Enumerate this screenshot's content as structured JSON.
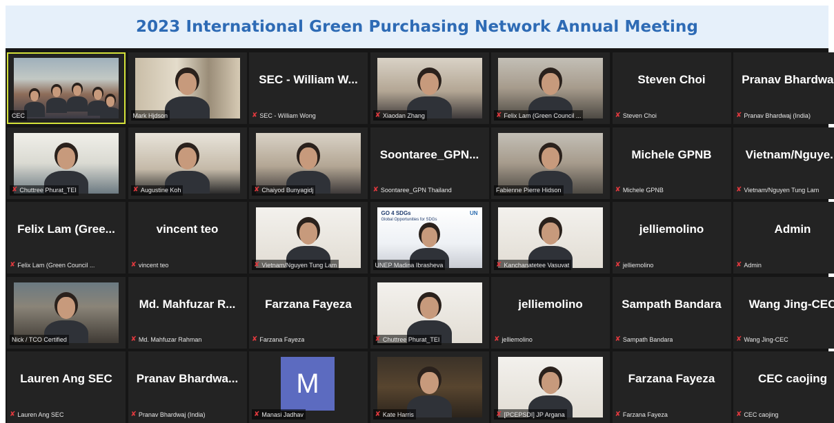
{
  "header": {
    "title": "2023 International Green Purchasing Network Annual Meeting"
  },
  "tiles": [
    {
      "big": "",
      "label": "CEC",
      "video": "v-room",
      "mic": false
    },
    {
      "big": "",
      "label": "Mark Hjdson",
      "video": "v-shelf",
      "mic": false
    },
    {
      "big": "SEC - William W...",
      "label": "SEC - William Wong",
      "video": "",
      "mic": true
    },
    {
      "big": "",
      "label": "Xiaodan Zhang",
      "video": "v-wall",
      "mic": true
    },
    {
      "big": "",
      "label": "Felix Lam (Green Council ...",
      "video": "v-room2",
      "mic": true
    },
    {
      "big": "Steven Choi",
      "label": "Steven Choi",
      "video": "",
      "mic": true
    },
    {
      "big": "Pranav  Bhardwa...",
      "label": "Pranav Bhardwaj (India)",
      "video": "",
      "mic": true
    },
    {
      "big": "",
      "label": "Chuttree Phurat_TEI",
      "video": "v-office",
      "mic": true
    },
    {
      "big": "",
      "label": "Augustine Koh",
      "video": "v-window",
      "mic": true
    },
    {
      "big": "",
      "label": "Chaiyod Bunyagidj",
      "video": "v-wall",
      "mic": true
    },
    {
      "big": "Soontaree_GPN...",
      "label": "Soontaree_GPN Thailand",
      "video": "",
      "mic": true
    },
    {
      "big": "",
      "label": "Fabienne Pierre Hidson",
      "video": "v-room2",
      "mic": false
    },
    {
      "big": "Michele GPNB",
      "label": "Michele GPNB",
      "video": "",
      "mic": true
    },
    {
      "big": "Vietnam/Nguye...",
      "label": "Vietnam/Nguyen Tung Lam",
      "video": "",
      "mic": true
    },
    {
      "big": "Felix Lam  (Gree...",
      "label": "Felix Lam (Green Council ...",
      "video": "",
      "mic": true
    },
    {
      "big": "vincent teo",
      "label": "vincent teo",
      "video": "",
      "mic": true
    },
    {
      "big": "",
      "label": "Vietnam/Nguyen Tung Lam",
      "video": "v-plain",
      "mic": true
    },
    {
      "big": "",
      "label": "UNEP Madina Ibrasheva",
      "video": "v-slide",
      "mic": false
    },
    {
      "big": "",
      "label": "Kanchanatetee Vasuvat",
      "video": "v-plain",
      "mic": true
    },
    {
      "big": "jelliemolino",
      "label": "jelliemolino",
      "video": "",
      "mic": true
    },
    {
      "big": "Admin",
      "label": "Admin",
      "video": "",
      "mic": true
    },
    {
      "big": "",
      "label": "Nick / TCO Certified",
      "video": "v-city",
      "mic": false
    },
    {
      "big": "Md. Mahfuzar R...",
      "label": "Md. Mahfuzar Rahman",
      "video": "",
      "mic": true
    },
    {
      "big": "Farzana Fayeza",
      "label": "Farzana Fayeza",
      "video": "",
      "mic": true
    },
    {
      "big": "",
      "label": "Chuttree Phurat_TEI",
      "video": "v-plain",
      "mic": true
    },
    {
      "big": "jelliemolino",
      "label": "jelliemolino",
      "video": "",
      "mic": true
    },
    {
      "big": "Sampath Bandara",
      "label": "Sampath Bandara",
      "video": "",
      "mic": true
    },
    {
      "big": "Wang Jing-CEC",
      "label": "Wang Jing-CEC",
      "video": "",
      "mic": true
    },
    {
      "big": "Lauren Ang SEC",
      "label": "Lauren Ang SEC",
      "video": "",
      "mic": true
    },
    {
      "big": "Pranav  Bhardwa...",
      "label": "Pranav Bhardwaj (India)",
      "video": "",
      "mic": true
    },
    {
      "big": "",
      "label": "Manasi Jadhav",
      "video": "avatar",
      "avatar_letter": "M",
      "mic": true
    },
    {
      "big": "",
      "label": "Kate Harris",
      "video": "v-dark",
      "mic": true
    },
    {
      "big": "",
      "label": "[PCEPSDI] JP Argana",
      "video": "v-plain",
      "mic": true
    },
    {
      "big": "Farzana Fayeza",
      "label": "Farzana Fayeza",
      "video": "",
      "mic": true
    },
    {
      "big": "CEC caojing",
      "label": "CEC caojing",
      "video": "",
      "mic": true
    }
  ],
  "slide": {
    "brand": "GO 4 SDGs",
    "sub": "Global Opportunities for SDGs",
    "corner": "UN"
  },
  "colors": {
    "title": "#2e6bb5",
    "title_bg": "#e6f0fa",
    "grid_bg": "#161616",
    "tile_bg": "#232323",
    "mic_muted": "#e0393e",
    "active_outline": "#d6e33a",
    "avatar_bg": "#5c6bc0"
  }
}
